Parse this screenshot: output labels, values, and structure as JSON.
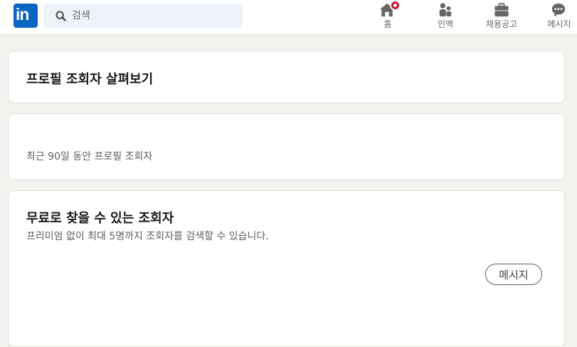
{
  "header": {
    "logo_text": "in",
    "search": {
      "placeholder": "검색"
    },
    "nav": {
      "home": "홈",
      "network": "인맥",
      "jobs": "채용공고",
      "messaging": "메시지"
    }
  },
  "main": {
    "page_title": "프로필 조회자 살펴보기",
    "viewers_summary": "최근 90일 동안 프로필 조회자",
    "free_section": {
      "title": "무료로 찾을 수 있는 조회자",
      "description": "프리미엄 없이 최대 5명까지 조회자를 검색할 수 있습니다.",
      "message_button": "메시지"
    }
  },
  "colors": {
    "brand": "#0a66c2",
    "notification": "#cb112d",
    "background": "#f4f2ee"
  },
  "icons": [
    "search-icon",
    "home-icon",
    "network-icon",
    "jobs-icon",
    "messaging-icon"
  ]
}
